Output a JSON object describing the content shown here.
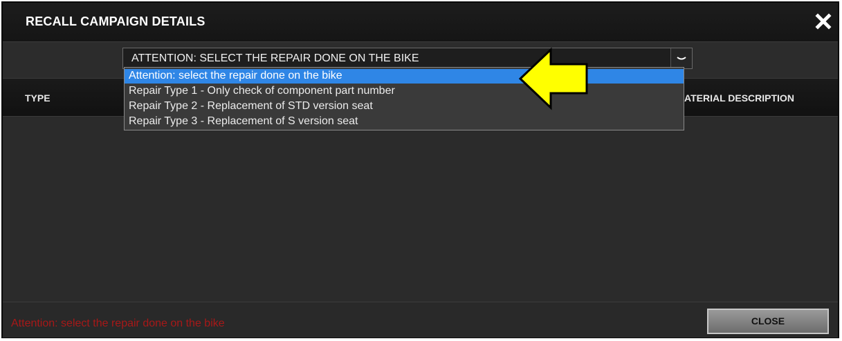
{
  "dialog": {
    "title": "RECALL CAMPAIGN DETAILS",
    "close_icon": "close-x-icon"
  },
  "toolbar": {
    "select_value": "ATTENTION: SELECT THE REPAIR DONE ON THE BIKE",
    "select_arrow_icon": "chevron-down-icon"
  },
  "table": {
    "columns": [
      "TYPE",
      "ATERIAL DESCRIPTION"
    ]
  },
  "dropdown": {
    "options": [
      "Attention: select the repair done on the bike",
      "Repair Type 1 - Only check of component part number",
      "Repair Type 2 - Replacement of STD version seat",
      "Repair Type 3 - Replacement of S version seat"
    ],
    "selected_index": 0
  },
  "annotation": {
    "pointer_icon": "yellow-arrow-icon",
    "color": "#ffff00"
  },
  "footer": {
    "status_text": "Attention: select the repair done on the bike",
    "status_color": "#a81818",
    "close_label": "CLOSE"
  },
  "colors": {
    "dialog_bg": "#2f2f2f",
    "selected_option": "#2f86e6"
  }
}
